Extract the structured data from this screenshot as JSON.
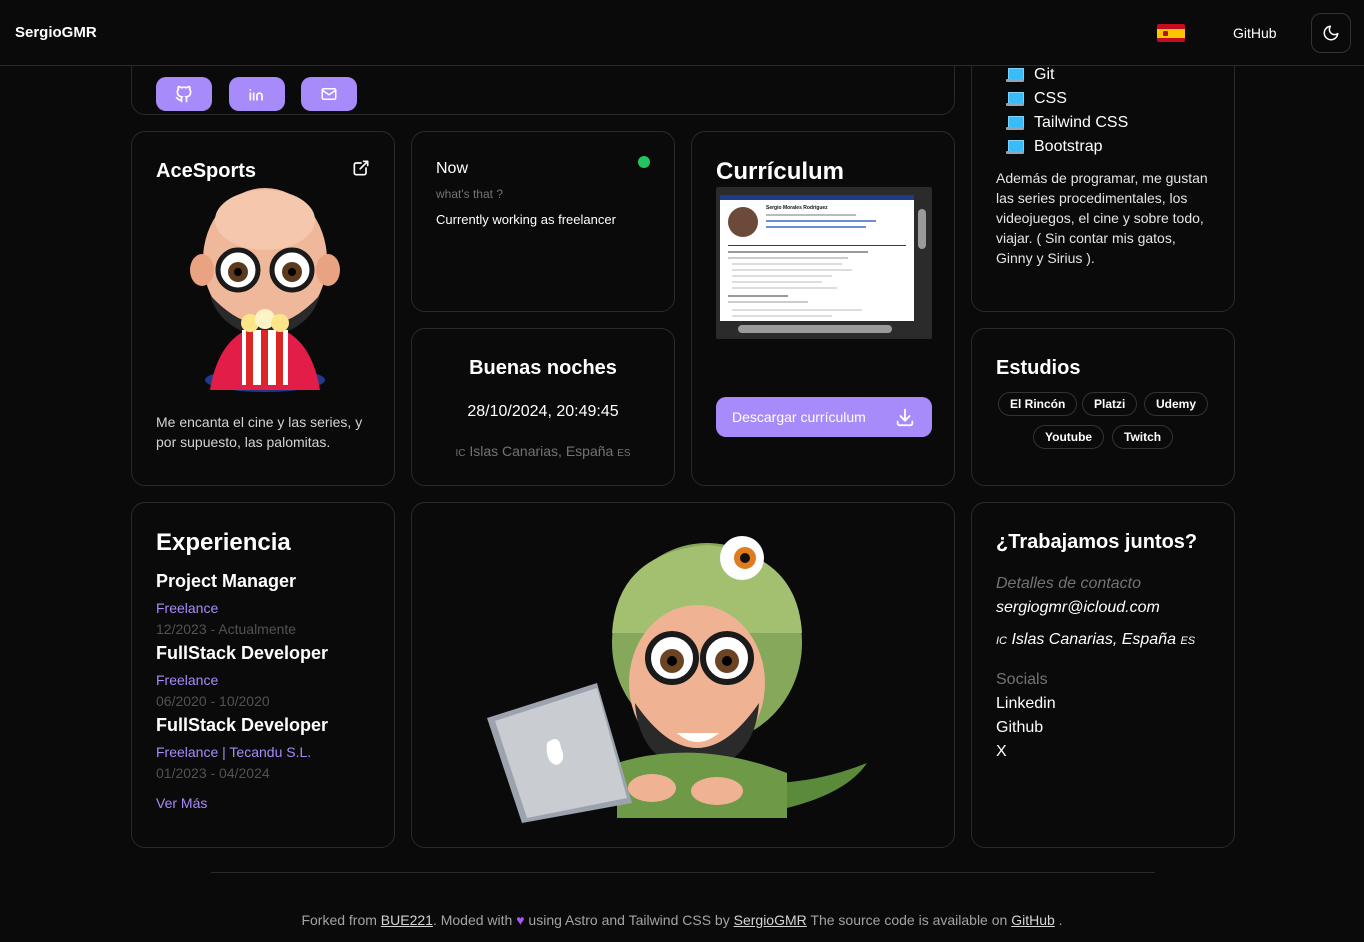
{
  "header": {
    "logo": "SergioGMR",
    "github_label": "GitHub",
    "flag_icon": "spain-flag-icon",
    "theme_icon": "moon-icon"
  },
  "social_buttons": [
    {
      "icon": "github-icon"
    },
    {
      "icon": "linkedin-icon"
    },
    {
      "icon": "mail-icon"
    }
  ],
  "tech_stack": [
    "Git",
    "CSS",
    "Tailwind CSS",
    "Bootstrap"
  ],
  "about": {
    "text": "Además de programar, me gustan las series procedimentales, los videojuegos, el cine y sobre todo, viajar. ( Sin contar mis gatos, Ginny y Sirius )."
  },
  "acesports": {
    "title": "AceSports",
    "text": "Me encanta el cine y las series, y por supuesto, las palomitas."
  },
  "now": {
    "title": "Now",
    "subtitle": "what's that ?",
    "status": "Currently working as freelancer",
    "status_color": "#22c55e"
  },
  "greeting": {
    "title": "Buenas noches",
    "datetime": "28/10/2024, 20:49:45",
    "location_prefix": "IC",
    "location": "Islas Canarias, España",
    "location_suffix": "ES"
  },
  "cv": {
    "title": "Currículum",
    "doc_name": "Sergio Morales Rodríguez",
    "download_label": "Descargar currículum"
  },
  "estudios": {
    "title": "Estudios",
    "items": [
      "El Rincón",
      "Platzi",
      "Udemy",
      "Youtube",
      "Twitch"
    ]
  },
  "experiencia": {
    "title": "Experiencia",
    "jobs": [
      {
        "role": "Project Manager",
        "company": "Freelance",
        "dates": "12/2023 - Actualmente"
      },
      {
        "role": "FullStack Developer",
        "company": "Freelance",
        "dates": "06/2020 - 10/2020"
      },
      {
        "role": "FullStack Developer",
        "company": "Freelance | Tecandu S.L.",
        "dates": "01/2023 - 04/2024"
      }
    ],
    "more_label": "Ver Más"
  },
  "contact": {
    "title": "¿Trabajamos juntos?",
    "details_label": "Detalles de contacto",
    "email": "sergiogmr@icloud.com",
    "location_prefix": "IC",
    "location": "Islas Canarias, España",
    "location_suffix": "ES",
    "socials_label": "Socials",
    "socials": [
      "Linkedin",
      "Github",
      "X"
    ]
  },
  "footer": {
    "part1": "Forked from",
    "link1": "BUE221",
    "part2": ". Moded with",
    "part3": "using Astro and Tailwind CSS by",
    "link2": "SergioGMR",
    "part4": "The source code is available on",
    "link3": "GitHub",
    "part5": "."
  },
  "colors": {
    "accent": "#a78bfa",
    "background": "#0a0a0a",
    "border": "#2a2a2a"
  }
}
